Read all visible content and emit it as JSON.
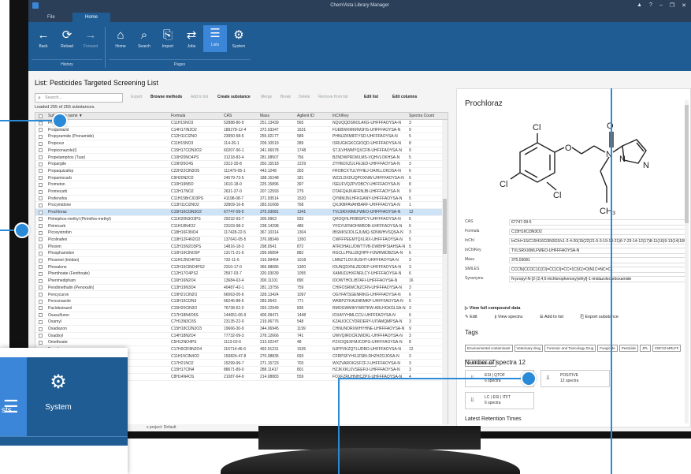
{
  "window": {
    "title": "ChemVista Library Manager",
    "controls": [
      "▲",
      "?",
      "–",
      "❐",
      "✕"
    ]
  },
  "ribbon": {
    "tabs": [
      "File",
      "Home"
    ],
    "buttons": [
      {
        "label": "Back",
        "icon": "←"
      },
      {
        "label": "Reload",
        "icon": "⟳"
      },
      {
        "label": "Forward",
        "icon": "→"
      },
      {
        "label": "Home",
        "icon": "⌂"
      },
      {
        "label": "Search",
        "icon": "⌕"
      },
      {
        "label": "Import",
        "icon": "⎘"
      },
      {
        "label": "Jobs",
        "icon": "⇄"
      },
      {
        "label": "Lists",
        "icon": "☰"
      },
      {
        "label": "System",
        "icon": "⚙"
      }
    ],
    "groups": [
      "History",
      "Pages"
    ]
  },
  "list": {
    "title": "List: Pesticides Targeted Screening List",
    "search_placeholder": "Search...",
    "loaded": "Loaded 255 of 255 substances.",
    "toolbar": [
      "Export",
      "Browse methods",
      "Add to list",
      "Create substance",
      "Merge",
      "Break",
      "Delete",
      "Remove from list",
      "Edit list",
      "Edit columns"
    ],
    "columns": [
      "Substance name ▼",
      "Formula",
      "CAS",
      "Mass",
      "Agilent ID",
      "InChIKey",
      "Spectra Count"
    ],
    "rows": [
      [
        "Propoxur",
        "C11H15NO3",
        "52888-80-9",
        "251.13439",
        "565",
        "NQUQQDSNOLAKG-UHFFFAOYSA-N",
        "3"
      ],
      [
        "Proquinazid",
        "C14H17IN2O2",
        "189278-12-4",
        "372.03347",
        "1631",
        "FUEBWXMKRMJHS-UHFFFAOYSA-N",
        "9"
      ],
      [
        "Propyzamide (Pronamide)",
        "C12H11Cl2NO",
        "23950-58-5",
        "255.02177",
        "589",
        "PHNUZKMIFFYSD-UHFFFAOYSA-N",
        "5"
      ],
      [
        "Propoxur",
        "C11H15NO3",
        "114-26-1",
        "209.10519",
        "289",
        "ISRUGKGKCGIOQD-UHFFFAOYSA-N",
        "8"
      ],
      [
        "Propiconazole(I)",
        "C15H17Cl2N3O2",
        "60207-90-1",
        "341.06978",
        "1748",
        "STJLVHWMYQXCFB-UHFFFAOYSA-N",
        "9"
      ],
      [
        "Propetamphos (Tuar)",
        "C10H20NO4PS",
        "31218-83-4",
        "281.08507",
        "756",
        "BZNDWPRDWLMS-VQHVLOKHSA-N",
        "5"
      ],
      [
        "Propargite",
        "C19H26O4S",
        "2312-35-8",
        "350.15518",
        "1229",
        "ZYHMJXZULFEJED-UHFFFAOYSA-N",
        "3"
      ],
      [
        "Propaquizafop",
        "C22H22ClN3O5",
        "111479-05-1",
        "443.1248",
        "303",
        "FROBCXTULYFHEJ-OAHLLOKOSA-N",
        "6"
      ],
      [
        "Propamocarb",
        "C9H20N2O2",
        "24579-73-5",
        "188.15248",
        "181",
        "WZZLDXDUQPOXNW-UHFFFAOYSA-N",
        "6"
      ],
      [
        "Prometon",
        "C10H19N5O",
        "1610-18-0",
        "225.15896",
        "397",
        "ISEUFVQZPVOBCY-UHFFFAOYSA-N",
        "8"
      ],
      [
        "Promecarb",
        "C12H17NO2",
        "2631-37-0",
        "207.12593",
        "279",
        "DTAFQAJKAFRNJB-UHFFFAOYSA-N",
        "9"
      ],
      [
        "Profenofos",
        "C11H15BrClO3PS",
        "41198-08-7",
        "371.93514",
        "1520",
        "QYMMJNLHFKGANY-UHFFFAOYSA-N",
        "5"
      ],
      [
        "Procymidone",
        "C13H11Cl2NO2",
        "32809-16-8",
        "283.01668",
        "768",
        "QXJKBPAVAHBARF-UHFFFAOYSA-N",
        "1"
      ],
      [
        "Prochloraz",
        "C15H16Cl3N3O2",
        "67747-09-5",
        "375.03081",
        "1341",
        "TVLSRXXIMLFWEO-UHFFFAOYSA-N",
        "12"
      ],
      [
        "Pirimiphos-methyl (Pirimifos-methyl)",
        "C11H20N3O3PS",
        "29232-93-7",
        "305.0963",
        "933",
        "QHOQHLPRIBSPCY-UHFFFAOYSA-N",
        "5"
      ],
      [
        "Pirimicarb",
        "C11H18N4O2",
        "23103-98-2",
        "238.14298",
        "486",
        "YFGYUFNIOHWBOB-UHFFFAOYSA-N",
        "6"
      ],
      [
        "Picoxystrobin",
        "C18H16F3NO4",
        "117428-22-5",
        "367.10314",
        "1304",
        "IBSNKSODLGJUMQ-SDNWHVSQSA-N",
        "3"
      ],
      [
        "Picolinafen",
        "C19H12F4N2O2",
        "137641-05-5",
        "376.08349",
        "1350",
        "CWFFPEEMTQXLRX-UHFFFAOYSA-N",
        "5"
      ],
      [
        "Phoxim",
        "C12H15N2O3PS",
        "14816-18-3",
        "298.0541",
        "872",
        "ATROHALUOWTTVB-DWBHPSIAHSA-N",
        "5"
      ],
      [
        "Phosphamidon",
        "C10H19ClNO5P",
        "13171-21-6",
        "299.06894",
        "882",
        "RGCLLPNLLBQHPF-HJWRWDBZSA-N",
        "6"
      ],
      [
        "Phosmet (Imidan)",
        "C11H12NO4PS2",
        "732-11-6",
        "316.99454",
        "1018",
        "LMNZTLDVJIUSHT-UHFFFAOYSA-N",
        "3"
      ],
      [
        "Phosalone",
        "C12H15ClNO4PS2",
        "2310-17-0",
        "366.98686",
        "1300",
        "IOUNQDXNLZEOEP-UHFFFAOYSA-N",
        "3"
      ],
      [
        "Phenthoate (Fenthoate)",
        "C12H17O4PS2",
        "2597-03-7",
        "320.03039",
        "1055",
        "XAMUDJHXFNRLCY-UHFFFAOYSA-N",
        "6"
      ],
      [
        "Phenmedipham",
        "C16H16N2O4",
        "13684-63-4",
        "300.11101",
        "890",
        "IDOWTHOLIBTAFI-UHFFFAOYSA-N",
        "16"
      ],
      [
        "Pendimethalin (Penoxalin)",
        "C13H19N3O4",
        "40487-42-1",
        "281.13756",
        "759",
        "CHIFOSRWCNZCFN-UHFFFAOYSA-N",
        "3"
      ],
      [
        "Pencycuron",
        "C19H21ClN2O",
        "66063-05-6",
        "328.13424",
        "1097",
        "OGYFATSGENRIKG-UHFFFAOYSA-N",
        "6"
      ],
      [
        "Penconazole",
        "C13H15Cl2N3",
        "66246-88-6",
        "283.0643",
        "771",
        "WKBPZYKAUNRMKP-UHFFFAOYSA-N",
        "6"
      ],
      [
        "Paclobutrazol",
        "C15H20ClN3O",
        "76738-62-0",
        "293.12949",
        "836",
        "RMOGWMIKYWRTKW-ARLHGKGLSA-N",
        "3"
      ],
      [
        "Oxasulfuron",
        "C17H18N4O6S",
        "144651-06-9",
        "406.09471",
        "1448",
        "IOXAYYHMLCCU-UHFFFAOYSA-N",
        "6"
      ],
      [
        "Oxamyl",
        "C7H13N3O3S",
        "23135-22-0",
        "219.06776",
        "548",
        "KZAUOCCYDRDERY-UITAMQMPSA-N",
        "3"
      ],
      [
        "Oxadiazon",
        "C15H18Cl2N2O3",
        "19666-30-9",
        "344.06945",
        "1199",
        "CHNUNORXWHYHNE-UHFFFAOYSA-N",
        "9"
      ],
      [
        "Oxadixyl",
        "C14H18N2O4",
        "77732-09-3",
        "278.12666",
        "741",
        "UWVQIROCRJWDKL-UHFFFAOYSA-N",
        "3"
      ],
      [
        "Omethoate",
        "C5H12NO4PS",
        "1113-02-6",
        "213.02247",
        "48",
        "PZXOQEXFMJCDPG-UHFFFAOYSA-N",
        "8"
      ],
      [
        "Novaluron",
        "C17H9ClF8N2O4",
        "116714-46-6",
        "492.01231",
        "1535",
        "NJPPVKZQTLUDBO-UHFFFAOYSA-N",
        "12"
      ],
      [
        "Nitenpyram",
        "C11H15ClN4O2",
        "150824-47-8",
        "270.08835",
        "693",
        "CFRPSFYHXJZSBI-DHZHZOJOSA-N",
        "3"
      ],
      [
        "Napropamide",
        "C17H21NO2",
        "15299-99-7",
        "271.15723",
        "703",
        "WXZVAROIGSFCFJ-UHFFFAOYSA-N",
        "3"
      ],
      [
        "Myclobutanil",
        "C15H17ClN4",
        "88671-89-0",
        "288.11417",
        "801",
        "HZJKXKUJVSEEFU-UHFFFAOYSA-N",
        "3"
      ],
      [
        "Metribuzin",
        "C8H14N4OS",
        "21087-64-9",
        "214.08883",
        "559",
        "FOXFZRUHNHCZPX-UHFFFAOYSA-N",
        "4"
      ]
    ],
    "selected_index": 13
  },
  "detail": {
    "name": "Prochloraz",
    "fields": [
      {
        "k": "CAS",
        "v": "67747-09-5"
      },
      {
        "k": "Formula",
        "v": "C15H16Cl3N3O2"
      },
      {
        "k": "InChI",
        "v": "InChI=1S/C15H16Cl3N3O2/c1-2-4-20(15(22)21-5-3-19-10-21)6-7-23-14-12(17)8-11(16)9-13(14)18/h3,5,8-10H,2"
      },
      {
        "k": "InChIKey",
        "v": "TVLSRXXIMLFWEO-UHFFFAOYSA-N"
      },
      {
        "k": "Mass",
        "v": "375.03081"
      },
      {
        "k": "SMILES",
        "v": "CCCN(CCOC1C(Cl)=CC(Cl)=CC=1Cl)C(=O)N1C=NC=C1"
      },
      {
        "k": "Synonyms",
        "v": "N-propyl-N-[2-(2,4,6-trichlorophenoxy)ethyl]-1-imidazolecarboxamide"
      }
    ],
    "view_full": "View full compound data",
    "actions": [
      "Edit",
      "View spectra",
      "Add to list",
      "Export substance"
    ],
    "tags_heading": "Tags",
    "tags": [
      "Environmental contaminant",
      "Veterinary drug",
      "Forensic and Toxicology Drug",
      "Fungicide",
      "Pesticide",
      "JPL",
      "CNF33 MRLFF",
      "LCMS Amenable"
    ],
    "spectra_heading": "Number of spectra 12",
    "spectra": [
      {
        "line1": "ESI | QTOF",
        "line2": "6 spectra"
      },
      {
        "line1": "POSITIVE",
        "line2": "12 spectra"
      },
      {
        "line1": "LC | ESI | ITFT",
        "line2": "6 spectra"
      }
    ],
    "latest_heading": "Latest Retention Times",
    "structure_atoms": {
      "cl": "Cl",
      "o": "O",
      "n": "N",
      "ch3": "CH₃"
    }
  },
  "status": "s project: Default",
  "zoom": {
    "lists_label": "sts",
    "system_label": "System"
  },
  "colors": {
    "ribbon": "#1f5c93",
    "accent": "#3b86d8",
    "titlebar": "#2b3f58",
    "callout": "#2a8ad8",
    "selected_row": "#cfe3f7"
  }
}
